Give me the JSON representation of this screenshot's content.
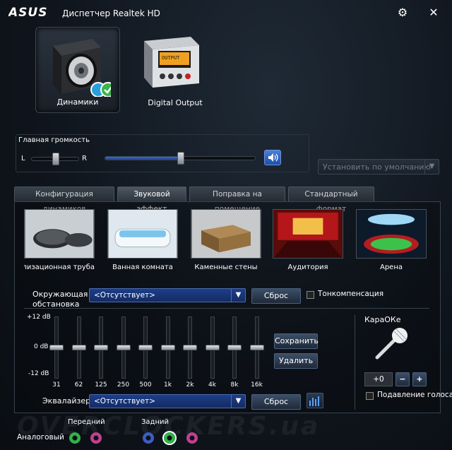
{
  "titlebar": {
    "logo": "/ISUS",
    "title": "Диспетчер Realtek HD",
    "settings_glyph": "⚙",
    "close_glyph": "✕"
  },
  "devices": [
    {
      "label": "Динамики",
      "selected": true,
      "icon": "speaker-icon"
    },
    {
      "label": "Digital Output",
      "selected": false,
      "icon": "digital-output-icon",
      "screen_text": "OUTPUT"
    }
  ],
  "volume": {
    "title": "Главная громкость",
    "left_label": "L",
    "right_label": "R",
    "balance_fraction": 0.5,
    "level_fraction": 0.5,
    "mute_icon": "speaker-volume-icon"
  },
  "default_button": {
    "label": "Установить по умолчанию"
  },
  "tabs": [
    {
      "label": "Конфигурация динамиков",
      "active": false
    },
    {
      "label": "Звуковой эффект",
      "active": true
    },
    {
      "label": "Поправка на помещение",
      "active": false
    },
    {
      "label": "Стандартный формат",
      "active": false
    }
  ],
  "effects": [
    {
      "label": "Канализационная труба",
      "icon": "sewer-pipe-icon"
    },
    {
      "label": "Ванная комната",
      "icon": "bathtub-icon"
    },
    {
      "label": "Каменные стены",
      "icon": "stone-walls-icon"
    },
    {
      "label": "Аудитория",
      "icon": "auditorium-icon"
    },
    {
      "label": "Арена",
      "icon": "arena-icon"
    }
  ],
  "environment": {
    "label_line1": "Окружающая",
    "label_line2": "обстановка",
    "value": "<Отсутствует>",
    "reset_label": "Сброс",
    "loudness_label": "Тонкомпенсация",
    "loudness_checked": false
  },
  "equalizer": {
    "db_top": "+12 dB",
    "db_mid": "0 dB",
    "db_bottom": "-12 dB",
    "bands": [
      "31",
      "62",
      "125",
      "250",
      "500",
      "1k",
      "2k",
      "4k",
      "8k",
      "16k"
    ],
    "gains_db": [
      0,
      0,
      0,
      0,
      0,
      0,
      0,
      0,
      0,
      0
    ],
    "save_label": "Сохранить",
    "delete_label": "Удалить",
    "label": "Эквалайзер",
    "preset": "<Отсутствует>",
    "reset_label": "Сброс"
  },
  "karaoke": {
    "title": "КараОКе",
    "value": "+0",
    "minus": "−",
    "plus": "+",
    "voice_cancel_label": "Подавление голоса",
    "voice_cancel_checked": false
  },
  "analog": {
    "label": "Аналоговый",
    "front_label": "Передний",
    "rear_label": "Задний",
    "colors": {
      "green": "#2fb34a",
      "pink": "#c0408f",
      "blue": "#3a5ec8"
    }
  },
  "watermark": "OVERCLOCKERS.ua"
}
